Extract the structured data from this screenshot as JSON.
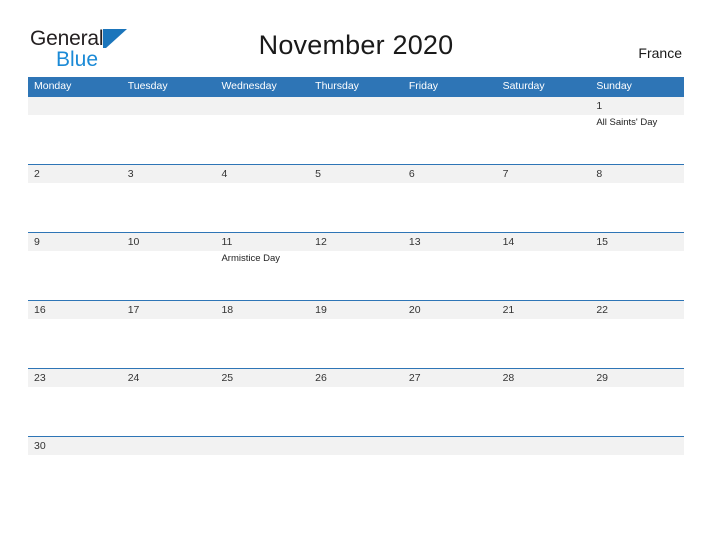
{
  "logo": {
    "word1": "General",
    "word2": "Blue",
    "mark": "triangle-flag-mark",
    "color_primary": "#1b75bb",
    "color_secondary": "#1b8ad6"
  },
  "header": {
    "title": "November 2020",
    "country": "France"
  },
  "theme": {
    "header_blue": "#2e75b6",
    "date_strip_gray": "#f2f2f2",
    "row_border": "#2e75b6",
    "text_dark": "#333333"
  },
  "calendar": {
    "month": "November",
    "year": "2020",
    "first_day_of_week": "Monday",
    "weekdays": [
      "Monday",
      "Tuesday",
      "Wednesday",
      "Thursday",
      "Friday",
      "Saturday",
      "Sunday"
    ],
    "weeks": [
      [
        {
          "day": "",
          "event": ""
        },
        {
          "day": "",
          "event": ""
        },
        {
          "day": "",
          "event": ""
        },
        {
          "day": "",
          "event": ""
        },
        {
          "day": "",
          "event": ""
        },
        {
          "day": "",
          "event": ""
        },
        {
          "day": "1",
          "event": "All Saints' Day"
        }
      ],
      [
        {
          "day": "2",
          "event": ""
        },
        {
          "day": "3",
          "event": ""
        },
        {
          "day": "4",
          "event": ""
        },
        {
          "day": "5",
          "event": ""
        },
        {
          "day": "6",
          "event": ""
        },
        {
          "day": "7",
          "event": ""
        },
        {
          "day": "8",
          "event": ""
        }
      ],
      [
        {
          "day": "9",
          "event": ""
        },
        {
          "day": "10",
          "event": ""
        },
        {
          "day": "11",
          "event": "Armistice Day"
        },
        {
          "day": "12",
          "event": ""
        },
        {
          "day": "13",
          "event": ""
        },
        {
          "day": "14",
          "event": ""
        },
        {
          "day": "15",
          "event": ""
        }
      ],
      [
        {
          "day": "16",
          "event": ""
        },
        {
          "day": "17",
          "event": ""
        },
        {
          "day": "18",
          "event": ""
        },
        {
          "day": "19",
          "event": ""
        },
        {
          "day": "20",
          "event": ""
        },
        {
          "day": "21",
          "event": ""
        },
        {
          "day": "22",
          "event": ""
        }
      ],
      [
        {
          "day": "23",
          "event": ""
        },
        {
          "day": "24",
          "event": ""
        },
        {
          "day": "25",
          "event": ""
        },
        {
          "day": "26",
          "event": ""
        },
        {
          "day": "27",
          "event": ""
        },
        {
          "day": "28",
          "event": ""
        },
        {
          "day": "29",
          "event": ""
        }
      ],
      [
        {
          "day": "30",
          "event": ""
        },
        {
          "day": "",
          "event": ""
        },
        {
          "day": "",
          "event": ""
        },
        {
          "day": "",
          "event": ""
        },
        {
          "day": "",
          "event": ""
        },
        {
          "day": "",
          "event": ""
        },
        {
          "day": "",
          "event": ""
        }
      ]
    ],
    "holidays": [
      {
        "date": "1",
        "name": "All Saints' Day"
      },
      {
        "date": "11",
        "name": "Armistice Day"
      }
    ]
  }
}
